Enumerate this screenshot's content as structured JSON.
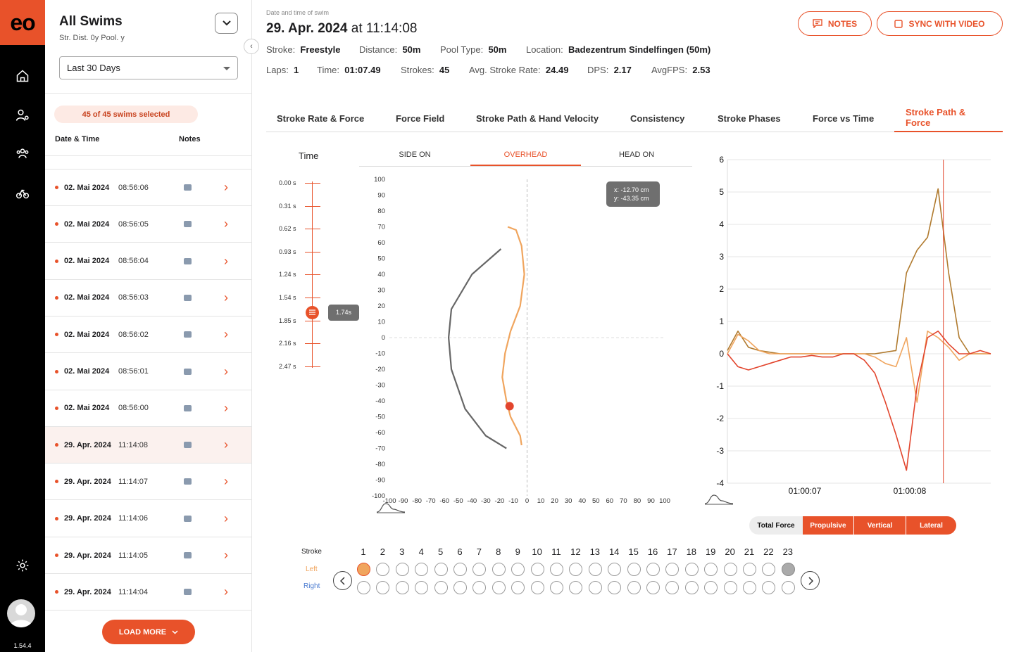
{
  "app": {
    "logo": "eo",
    "version": "1.54.4"
  },
  "nav": {
    "icons": [
      "home-icon",
      "user-settings-icon",
      "team-icon",
      "triathlon-icon",
      "settings-icon"
    ]
  },
  "sidebar": {
    "title": "All Swims",
    "subtitle": "Str.  Dist. 0y  Pool. y",
    "range": "Last  30 Days",
    "selected": "45 of 45 swims selected",
    "col_date": "Date & Time",
    "col_notes": "Notes",
    "rows": [
      {
        "date": "02. Mai 2024",
        "time": "08:56:06"
      },
      {
        "date": "02. Mai 2024",
        "time": "08:56:05"
      },
      {
        "date": "02. Mai 2024",
        "time": "08:56:04"
      },
      {
        "date": "02. Mai 2024",
        "time": "08:56:03"
      },
      {
        "date": "02. Mai 2024",
        "time": "08:56:02"
      },
      {
        "date": "02. Mai 2024",
        "time": "08:56:01"
      },
      {
        "date": "02. Mai 2024",
        "time": "08:56:00"
      },
      {
        "date": "29. Apr. 2024",
        "time": "11:14:08"
      },
      {
        "date": "29. Apr. 2024",
        "time": "11:14:07"
      },
      {
        "date": "29. Apr. 2024",
        "time": "11:14:06"
      },
      {
        "date": "29. Apr. 2024",
        "time": "11:14:05"
      },
      {
        "date": "29. Apr. 2024",
        "time": "11:14:04"
      }
    ],
    "load_more": "LOAD MORE"
  },
  "swim": {
    "caption": "Date and time of swim",
    "date": "29. Apr. 2024",
    "at": "at",
    "time": "11:14:08",
    "stroke_label": "Stroke:",
    "stroke": "Freestyle",
    "distance_label": "Distance:",
    "distance": "50m",
    "pool_label": "Pool Type:",
    "pool": "50m",
    "location_label": "Location:",
    "location": "Badezentrum Sindelfingen (50m)",
    "laps_label": "Laps:",
    "laps": "1",
    "time_label": "Time:",
    "duration": "01:07.49",
    "strokes_label": "Strokes:",
    "strokes": "45",
    "rate_label": "Avg. Stroke Rate:",
    "rate": "24.49",
    "dps_label": "DPS:",
    "dps": "2.17",
    "fps_label": "AvgFPS:",
    "fps": "2.53"
  },
  "actions": {
    "notes": "NOTES",
    "sync": "SYNC WITH VIDEO"
  },
  "tabs": [
    "Stroke Rate & Force",
    "Force Field",
    "Stroke Path & Hand Velocity",
    "Consistency",
    "Stroke Phases",
    "Force vs Time",
    "Stroke Path & Force"
  ],
  "active_tab": "Stroke Path & Force",
  "timeline": {
    "title": "Time",
    "ticks": [
      "0.00 s",
      "0.31 s",
      "0.62 s",
      "0.93 s",
      "1.24 s",
      "1.54 s",
      "1.85 s",
      "2.16 s",
      "2.47 s"
    ],
    "current": "1.74s",
    "current_value": 1.74
  },
  "views": [
    "SIDE ON",
    "OVERHEAD",
    "HEAD ON"
  ],
  "active_view": "OVERHEAD",
  "tooltip": {
    "x": "x: -12.70 cm",
    "y": "y: -43.35 cm"
  },
  "chart_data": [
    {
      "type": "line",
      "title": "",
      "xlim": [
        -100,
        100
      ],
      "ylim": [
        -100,
        100
      ],
      "x_ticks": [
        -100,
        -90,
        -80,
        -70,
        -60,
        -50,
        -40,
        -30,
        -20,
        -10,
        0,
        10,
        20,
        30,
        40,
        50,
        60,
        70,
        80,
        90,
        100
      ],
      "y_ticks": [
        100,
        90,
        80,
        70,
        60,
        50,
        40,
        30,
        20,
        10,
        0,
        -10,
        -20,
        -30,
        -40,
        -50,
        -60,
        -70,
        -80,
        -90,
        -100
      ],
      "series": [
        {
          "color": "#666666",
          "points": [
            [
              -19,
              56
            ],
            [
              -40,
              40
            ],
            [
              -55,
              18
            ],
            [
              -57,
              0
            ],
            [
              -55,
              -20
            ],
            [
              -45,
              -45
            ],
            [
              -30,
              -62
            ],
            [
              -15,
              -70
            ]
          ]
        },
        {
          "color": "#f0a55e",
          "points": [
            [
              -14,
              70
            ],
            [
              -8,
              68
            ],
            [
              -4,
              58
            ],
            [
              -2,
              40
            ],
            [
              -5,
              20
            ],
            [
              -12,
              4
            ],
            [
              -16,
              -10
            ],
            [
              -18,
              -25
            ],
            [
              -15,
              -40
            ],
            [
              -12,
              -50
            ],
            [
              -5,
              -62
            ],
            [
              -4,
              -68
            ]
          ]
        }
      ],
      "marker": {
        "x": -12.7,
        "y": -43.35
      }
    },
    {
      "type": "line",
      "title": "",
      "ylim": [
        -4,
        6
      ],
      "y_ticks": [
        6,
        5,
        4,
        3,
        2,
        1,
        0,
        -1,
        -2,
        -3,
        -4
      ],
      "x_tick_labels": [
        "01:00:07",
        "01:00:08"
      ],
      "cursor_label": "01:00:08",
      "series": [
        {
          "name": "Total Force",
          "color": "#b07a2e",
          "values": [
            0.1,
            0.7,
            0.2,
            0.1,
            0.05,
            0.0,
            0.0,
            0.0,
            0.0,
            0.0,
            0.0,
            0.0,
            0.0,
            0.0,
            0.0,
            0.05,
            0.1,
            2.5,
            3.2,
            3.6,
            5.1,
            2.5,
            0.5,
            0.0,
            0.0,
            0.0
          ]
        },
        {
          "name": "Propulsive",
          "color": "#f0a55e",
          "values": [
            0.0,
            0.6,
            0.4,
            0.1,
            0.0,
            0.0,
            0.0,
            0.0,
            0.0,
            0.0,
            0.0,
            0.0,
            0.0,
            0.0,
            -0.1,
            -0.3,
            -0.4,
            0.5,
            -1.5,
            0.7,
            0.5,
            0.2,
            -0.2,
            0.0,
            0.0,
            0.0
          ]
        },
        {
          "name": "Vertical",
          "color": "#e2452d",
          "values": [
            0.0,
            -0.4,
            -0.5,
            -0.4,
            -0.3,
            -0.2,
            -0.1,
            -0.1,
            -0.05,
            -0.1,
            -0.1,
            0.0,
            0.0,
            -0.2,
            -0.6,
            -1.5,
            -2.5,
            -3.6,
            -1.0,
            0.5,
            0.7,
            0.3,
            0.0,
            0.0,
            0.1,
            0.0
          ]
        }
      ]
    }
  ],
  "force_buttons": [
    "Total Force",
    "Propulsive",
    "Vertical",
    "Lateral"
  ],
  "active_force": "Total Force",
  "strokes_selector": {
    "label": "Stroke",
    "left_label": "Left",
    "right_label": "Right",
    "numbers": [
      "1",
      "2",
      "3",
      "4",
      "5",
      "6",
      "7",
      "8",
      "9",
      "10",
      "11",
      "12",
      "13",
      "14",
      "15",
      "16",
      "17",
      "18",
      "19",
      "20",
      "21",
      "22",
      "23"
    ],
    "selected_left": "1"
  },
  "colors": {
    "accent": "#e8522a",
    "accent_light": "#fdeae4",
    "left_stroke": "#f0a55e",
    "right_label": "#4a7bd0"
  }
}
